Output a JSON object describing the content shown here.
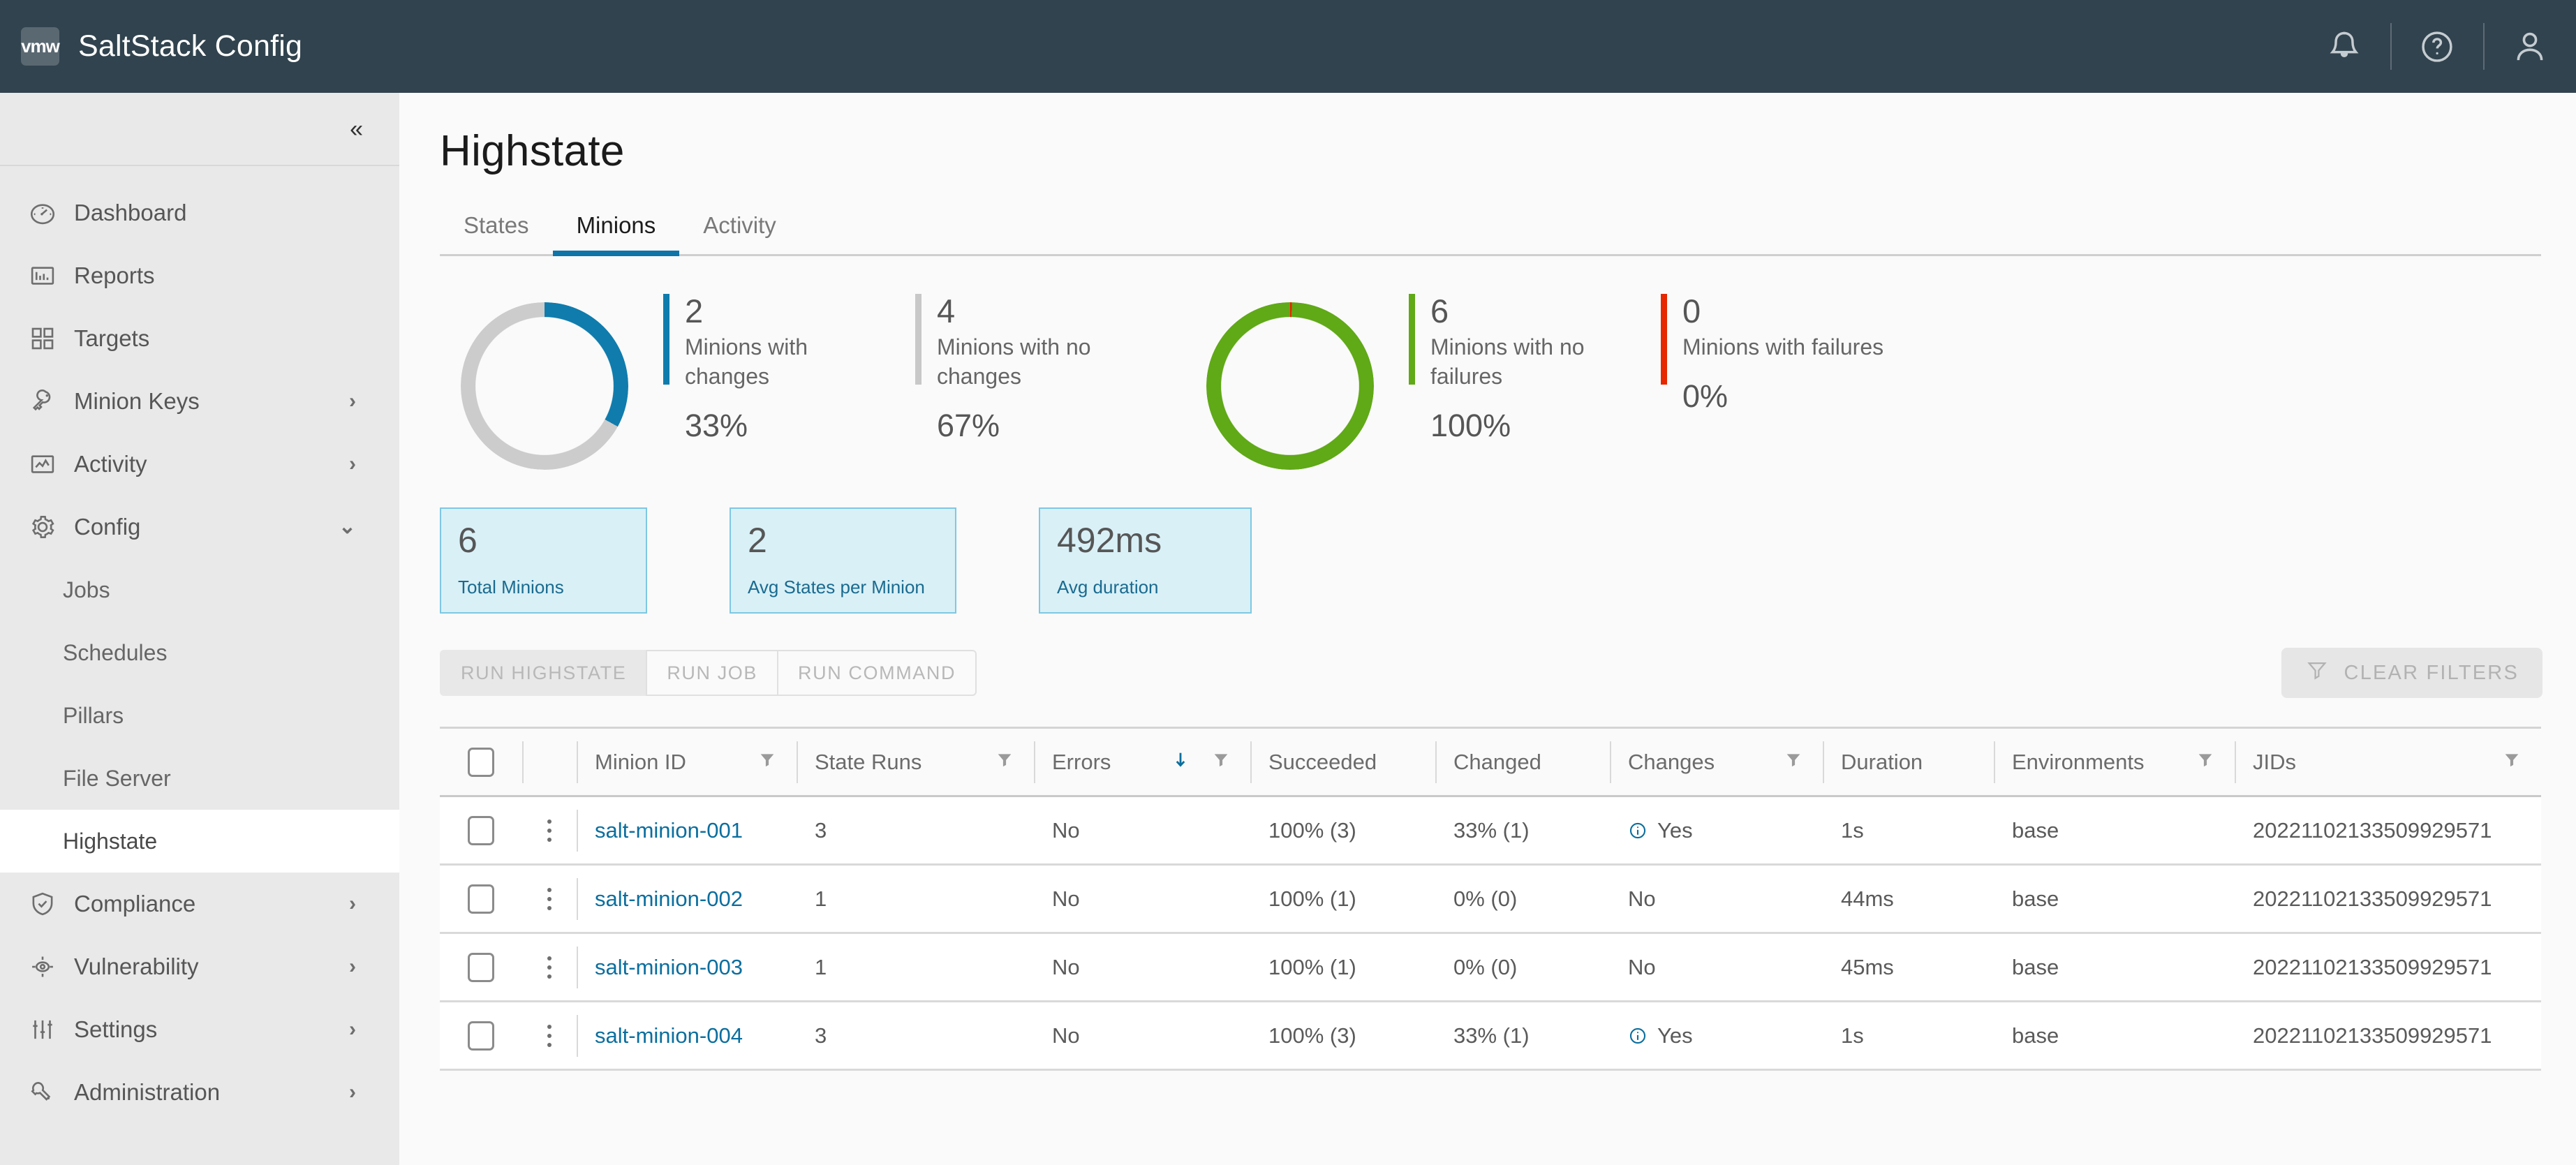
{
  "topbar": {
    "logo_text": "vmw",
    "title": "SaltStack Config",
    "icons": [
      "notification-bell-icon",
      "help-icon",
      "user-account-icon"
    ]
  },
  "sidebar": {
    "collapse_label": "«",
    "items": [
      {
        "label": "Dashboard",
        "icon": "gauge-icon",
        "chevron": ""
      },
      {
        "label": "Reports",
        "icon": "bar-chart-icon",
        "chevron": ""
      },
      {
        "label": "Targets",
        "icon": "grid-icon",
        "chevron": ""
      },
      {
        "label": "Minion Keys",
        "icon": "key-icon",
        "chevron": "›"
      },
      {
        "label": "Activity",
        "icon": "line-chart-icon",
        "chevron": "›"
      },
      {
        "label": "Config",
        "icon": "gear-icon",
        "chevron": "⌄"
      }
    ],
    "config_children": [
      {
        "label": "Jobs",
        "active": false
      },
      {
        "label": "Schedules",
        "active": false
      },
      {
        "label": "Pillars",
        "active": false
      },
      {
        "label": "File Server",
        "active": false
      },
      {
        "label": "Highstate",
        "active": true
      }
    ],
    "items_bottom": [
      {
        "label": "Compliance",
        "icon": "shield-check-icon",
        "chevron": "›"
      },
      {
        "label": "Vulnerability",
        "icon": "target-eye-icon",
        "chevron": "›"
      },
      {
        "label": "Settings",
        "icon": "sliders-icon",
        "chevron": "›"
      },
      {
        "label": "Administration",
        "icon": "wrench-icon",
        "chevron": "›"
      }
    ]
  },
  "main": {
    "page_title": "Highstate",
    "tabs": [
      {
        "label": "States",
        "active": false
      },
      {
        "label": "Minions",
        "active": true
      },
      {
        "label": "Activity",
        "active": false
      }
    ]
  },
  "chart_data": [
    {
      "type": "pie",
      "title": "Minion changes",
      "categories": [
        "Minions with changes",
        "Minions with no changes"
      ],
      "values": [
        2,
        4
      ],
      "percentages": [
        "33%",
        "67%"
      ],
      "colors": [
        "#0f7cad",
        "#cccccc"
      ]
    },
    {
      "type": "pie",
      "title": "Minion failures",
      "categories": [
        "Minions with no failures",
        "Minions with failures"
      ],
      "values": [
        6,
        0
      ],
      "percentages": [
        "100%",
        "0%"
      ],
      "colors": [
        "#60a917",
        "#e62700"
      ]
    }
  ],
  "donut_legends": [
    {
      "count": "2",
      "text": "Minions with changes",
      "pct": "33%",
      "color": "#0f7cad"
    },
    {
      "count": "4",
      "text": "Minions with no changes",
      "pct": "67%",
      "color": "#c8c8c8"
    },
    {
      "count": "6",
      "text": "Minions with no failures",
      "pct": "100%",
      "color": "#60a917"
    },
    {
      "count": "0",
      "text": "Minions with failures",
      "pct": "0%",
      "color": "#e62700"
    }
  ],
  "kpis": [
    {
      "value": "6",
      "label": "Total Minions"
    },
    {
      "value": "2",
      "label": "Avg States per Minion"
    },
    {
      "value": "492ms",
      "label": "Avg duration"
    }
  ],
  "actions": {
    "buttons": [
      "RUN HIGHSTATE",
      "RUN JOB",
      "RUN COMMAND"
    ],
    "clear_filters": "CLEAR FILTERS"
  },
  "table": {
    "columns": [
      {
        "label": "Minion ID",
        "filter": true,
        "sort": false
      },
      {
        "label": "State Runs",
        "filter": true,
        "sort": false
      },
      {
        "label": "Errors",
        "filter": true,
        "sort": true
      },
      {
        "label": "Succeeded",
        "filter": false,
        "sort": false
      },
      {
        "label": "Changed",
        "filter": false,
        "sort": false
      },
      {
        "label": "Changes",
        "filter": true,
        "sort": false
      },
      {
        "label": "Duration",
        "filter": false,
        "sort": false
      },
      {
        "label": "Environments",
        "filter": true,
        "sort": false
      },
      {
        "label": "JIDs",
        "filter": true,
        "sort": false
      }
    ],
    "rows": [
      {
        "minion_id": "salt-minion-001",
        "state_runs": "3",
        "errors": "No",
        "succeeded": "100% (3)",
        "changed": "33% (1)",
        "changes": "Yes",
        "changes_info": true,
        "duration": "1s",
        "environments": "base",
        "jids": "20221102133509929571"
      },
      {
        "minion_id": "salt-minion-002",
        "state_runs": "1",
        "errors": "No",
        "succeeded": "100% (1)",
        "changed": "0% (0)",
        "changes": "No",
        "changes_info": false,
        "duration": "44ms",
        "environments": "base",
        "jids": "20221102133509929571"
      },
      {
        "minion_id": "salt-minion-003",
        "state_runs": "1",
        "errors": "No",
        "succeeded": "100% (1)",
        "changed": "0% (0)",
        "changes": "No",
        "changes_info": false,
        "duration": "45ms",
        "environments": "base",
        "jids": "20221102133509929571"
      },
      {
        "minion_id": "salt-minion-004",
        "state_runs": "3",
        "errors": "No",
        "succeeded": "100% (3)",
        "changed": "33% (1)",
        "changes": "Yes",
        "changes_info": true,
        "duration": "1s",
        "environments": "base",
        "jids": "20221102133509929571"
      }
    ]
  },
  "colors": {
    "header_bg": "#31434e",
    "accent_blue": "#0f74a8",
    "green": "#60a917",
    "red": "#e62700",
    "grey": "#cccccc",
    "kpi_bg": "#d9f0f7",
    "kpi_border": "#7ec8e3"
  }
}
